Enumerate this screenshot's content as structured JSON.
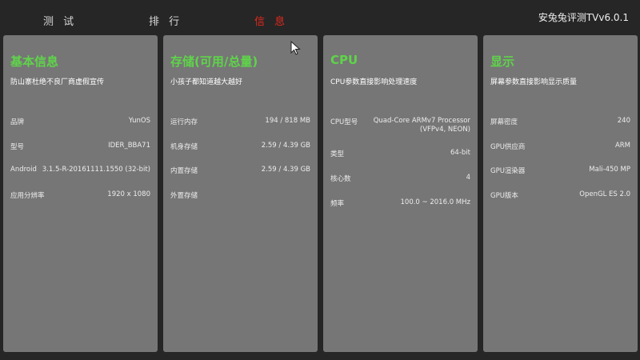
{
  "tabs": [
    {
      "label": "测 试",
      "active": false
    },
    {
      "label": "排 行",
      "active": false
    },
    {
      "label": "信 息",
      "active": true
    }
  ],
  "app_title": "安兔兔评测TVv6.0.1",
  "colors": {
    "background": "#262626",
    "card": "#767676",
    "card_title": "#5fd44a",
    "active_tab": "#e0291c"
  },
  "cards": [
    {
      "title": "基本信息",
      "subtitle": "防山寨杜绝不良厂商虚假宣传",
      "rows": [
        {
          "key": "品牌",
          "value": "YunOS"
        },
        {
          "key": "型号",
          "value": "IDER_BBA71"
        },
        {
          "key": "Android",
          "value": "3.1.5-R-20161111.1550 (32-bit)"
        },
        {
          "key": "应用分辨率",
          "value": "1920 x 1080"
        }
      ]
    },
    {
      "title": "存储(可用/总量)",
      "subtitle": "小孩子都知道越大越好",
      "rows": [
        {
          "key": "运行内存",
          "value": "194 / 818 MB"
        },
        {
          "key": "机身存储",
          "value": "2.59 / 4.39 GB"
        },
        {
          "key": "内置存储",
          "value": "2.59 / 4.39 GB"
        },
        {
          "key": "外置存储",
          "value": ""
        }
      ]
    },
    {
      "title": "CPU",
      "subtitle": "CPU参数直接影响处理速度",
      "rows": [
        {
          "key": "CPU型号",
          "value": "Quad-Core ARMv7 Processor\n(VFPv4, NEON)"
        },
        {
          "key": "类型",
          "value": "64-bit"
        },
        {
          "key": "核心数",
          "value": "4"
        },
        {
          "key": "频率",
          "value": "100.0 ~ 2016.0 MHz"
        }
      ]
    },
    {
      "title": "显示",
      "subtitle": "屏幕参数直接影响显示质量",
      "rows": [
        {
          "key": "屏幕密度",
          "value": "240"
        },
        {
          "key": "GPU供应商",
          "value": "ARM"
        },
        {
          "key": "GPU渲染器",
          "value": "Mali-450 MP"
        },
        {
          "key": "GPU版本",
          "value": "OpenGL ES 2.0"
        }
      ]
    }
  ]
}
